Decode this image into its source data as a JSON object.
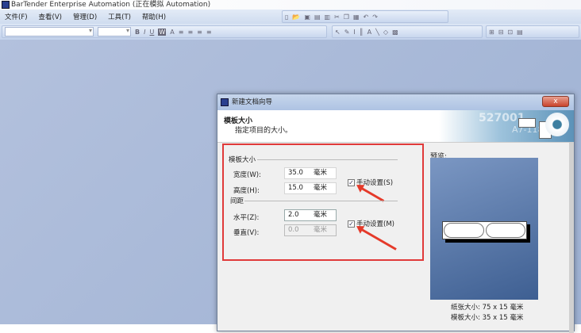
{
  "app": {
    "title": "BarTender Enterprise Automation (正在模拟 Automation)"
  },
  "menu": [
    "文件(F)",
    "查看(V)",
    "管理(D)",
    "工具(T)",
    "帮助(H)"
  ],
  "toolbar": {
    "bold": "B",
    "italic": "I",
    "underline": "U",
    "word": "W",
    "font_color": "A"
  },
  "dialog": {
    "title": "新建文档向导",
    "close": "x",
    "header_title": "模板大小",
    "header_subtitle": "指定项目的大小。",
    "banner_text": [
      "527001",
      "A7-118"
    ],
    "template_group": "模板大小",
    "width_label": "宽度(W):",
    "width_value": "35.0",
    "width_unit": "毫米",
    "height_label": "高度(H):",
    "height_value": "15.0",
    "height_unit": "毫米",
    "manual_size": "手动设置(S)",
    "manual_size_checked": true,
    "spacing_group": "间距",
    "horizontal_label": "水平(Z):",
    "horizontal_value": "2.0",
    "horizontal_unit": "毫米",
    "vertical_label": "垂直(V):",
    "vertical_value": "0.0",
    "vertical_unit": "毫米",
    "manual_spacing": "手动设置(M)",
    "manual_spacing_checked": true,
    "preview_label": "预览:",
    "paper_size": "纸张大小:  75 x 15 毫米",
    "template_size": "模板大小:  35 x 15 毫米"
  }
}
